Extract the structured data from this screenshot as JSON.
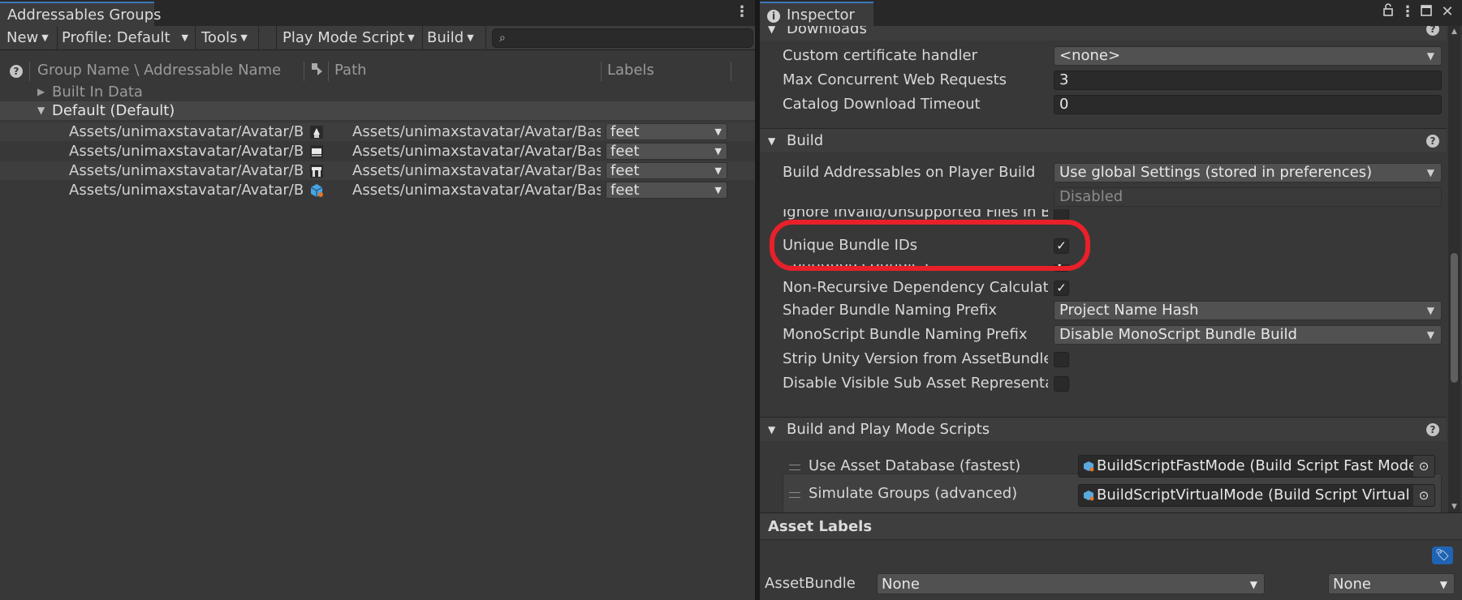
{
  "left": {
    "tab_title": "Addressables Groups",
    "menu_icon": "kebab-menu-icon",
    "toolbar": {
      "new": "New",
      "profile": "Profile: Default",
      "tools": "Tools",
      "play_mode": "Play Mode Script",
      "build": "Build",
      "search_placeholder": "⌕",
      "search_icon": "search-icon"
    },
    "columns": {
      "name": "Group Name \\ Addressable Name",
      "path": "Path",
      "labels": "Labels"
    },
    "groups": [
      {
        "label": "Built In Data",
        "expanded": false
      },
      {
        "label": "Default (Default)",
        "expanded": true
      }
    ],
    "assets": [
      {
        "name": "Assets/unimaxstavatar/Avatar/Bas",
        "path": "Assets/unimaxstavatar/Avatar/Base",
        "label": "feet",
        "icon": "mesh-preview-icon"
      },
      {
        "name": "Assets/unimaxstavatar/Avatar/Bas",
        "path": "Assets/unimaxstavatar/Avatar/Base",
        "label": "feet",
        "icon": "mesh-preview-icon"
      },
      {
        "name": "Assets/unimaxstavatar/Avatar/Bas",
        "path": "Assets/unimaxstavatar/Avatar/Base",
        "label": "feet",
        "icon": "mesh-preview-icon"
      },
      {
        "name": "Assets/unimaxstavatar/Avatar/Bas",
        "path": "Assets/unimaxstavatar/Avatar/Base",
        "label": "feet",
        "icon": "prefab-cube-icon"
      }
    ]
  },
  "right": {
    "tab_title": "Inspector",
    "sections": {
      "downloads": "Downloads",
      "build": "Build",
      "scripts": "Build and Play Mode Scripts"
    },
    "downloads_rows": [
      {
        "label": "Custom certificate handler",
        "value": "<none>"
      },
      {
        "label": "Max Concurrent Web Requests",
        "value": "3"
      },
      {
        "label": "Catalog Download Timeout",
        "value": "0"
      }
    ],
    "build_rows": {
      "build_on_player": {
        "label": "Build Addressables on Player Build",
        "value": "Use global Settings (stored in preferences)"
      },
      "disabled_text": "Disabled",
      "ignore_invalid": {
        "label": "Ignore Invalid/Unsupported Files in Build",
        "checked": false
      },
      "unique_ids": {
        "label": "Unique Bundle IDs",
        "checked": true
      },
      "contiguous": {
        "label": "Contiguous Bundles",
        "checked": true
      },
      "non_recursive": {
        "label": "Non-Recursive Dependency Calculation",
        "checked": true
      },
      "shader_prefix": {
        "label": "Shader Bundle Naming Prefix",
        "value": "Project Name Hash"
      },
      "mono_prefix": {
        "label": "MonoScript Bundle Naming Prefix",
        "value": "Disable MonoScript Bundle Build"
      },
      "strip_version": {
        "label": "Strip Unity Version from AssetBundles",
        "checked": false
      },
      "disable_visible": {
        "label": "Disable Visible Sub Asset Representations",
        "checked": false
      }
    },
    "scripts": [
      {
        "label": "Use Asset Database (fastest)",
        "value": "BuildScriptFastMode (Build Script Fast Mode)"
      },
      {
        "label": "Simulate Groups (advanced)",
        "value": "BuildScriptVirtualMode (Build Script Virtual Mode)"
      }
    ],
    "asset_labels": {
      "title": "Asset Labels",
      "assetbundle_label": "AssetBundle",
      "bundle_value": "None",
      "variant_value": "None"
    },
    "annotation_color": "#e8202a"
  }
}
